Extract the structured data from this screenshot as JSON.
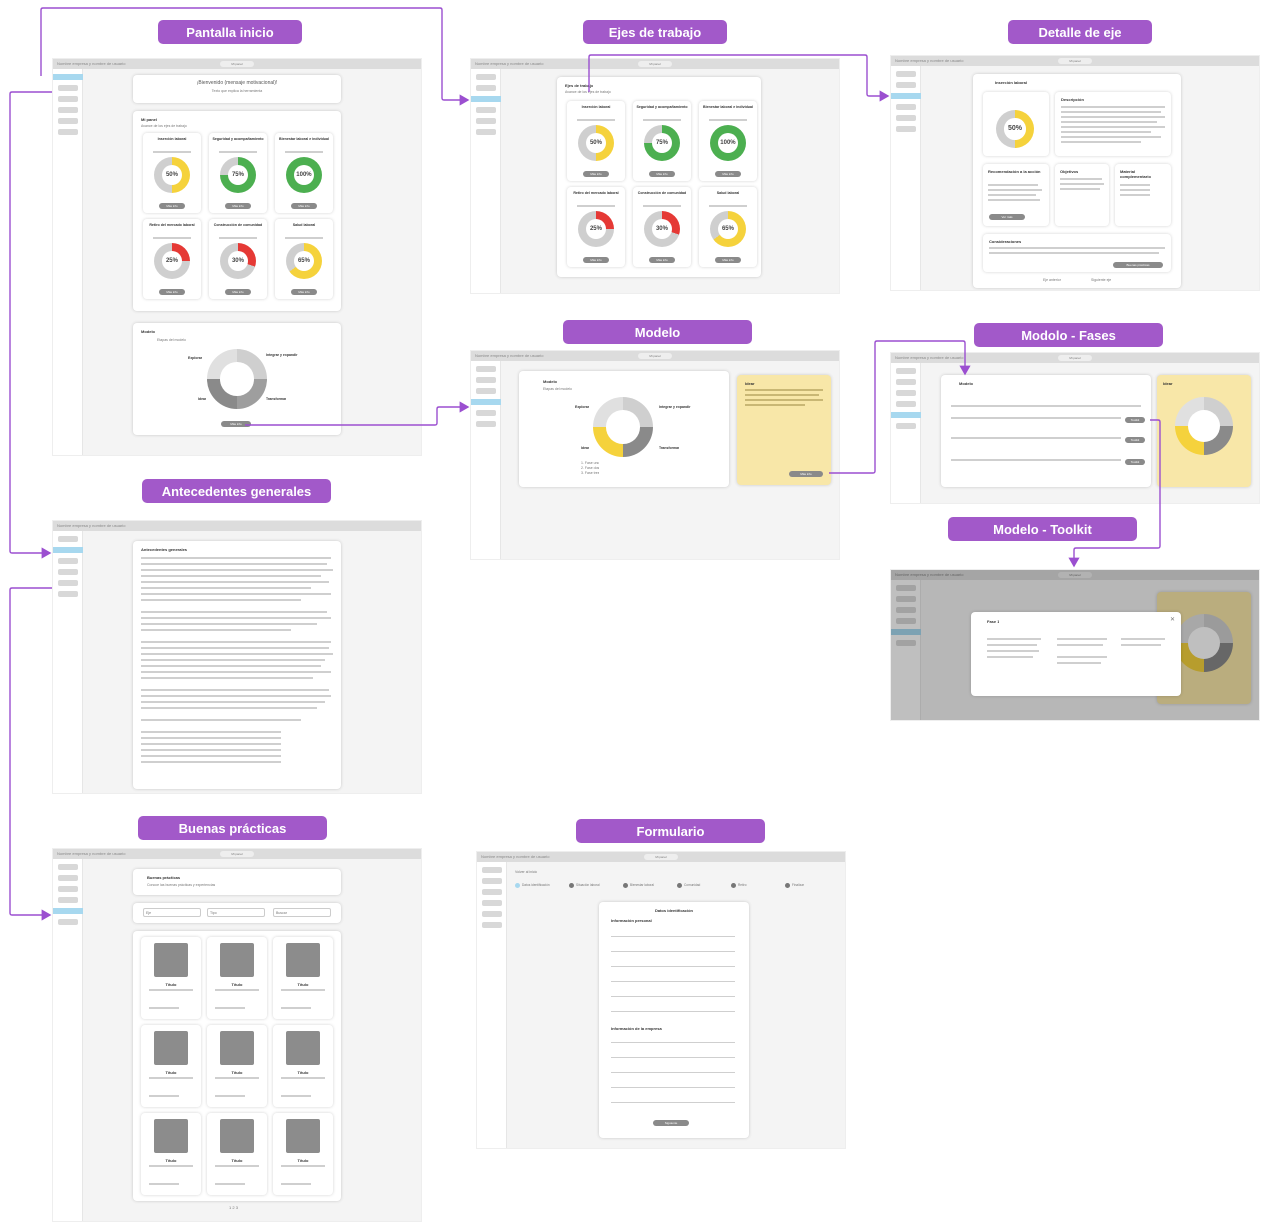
{
  "colors": {
    "accent": "#a259c9",
    "yellow": "#f5d23c",
    "green": "#4caf50",
    "red": "#e53935",
    "gray": "#8a8a8a",
    "panel_yellow": "#f8e7a8",
    "selected": "#a7d8ef"
  },
  "labels": {
    "pantalla_inicio": "Pantalla inicio",
    "ejes_de_trabajo": "Ejes de trabajo",
    "detalle_de_eje": "Detalle de eje",
    "modelo": "Modelo",
    "modelo_fases": "Modolo - Fases",
    "modelo_toolkit": "Modelo - Toolkit",
    "antecedentes_generales": "Antecedentes generales",
    "buenas_practicas": "Buenas prácticas",
    "formulario": "Formulario"
  },
  "home": {
    "welcome": "¡Bienvenido (mensaje motivacional)!",
    "welcome_sub": "Texto que explica la herramienta",
    "panel_title": "Mi panel",
    "panel_sub": "Avance de los ejes de trabajo",
    "axes": [
      {
        "name": "Inserción laboral",
        "pct": "50%",
        "value": 50,
        "color": "yellow"
      },
      {
        "name": "Seguridad y acompañamiento",
        "pct": "75%",
        "value": 75,
        "color": "green"
      },
      {
        "name": "Bienestar laboral e individual",
        "pct": "100%",
        "value": 100,
        "color": "green"
      },
      {
        "name": "Retiro del mercado laboral",
        "pct": "25%",
        "value": 25,
        "color": "red"
      },
      {
        "name": "Construcción de comunidad",
        "pct": "30%",
        "value": 30,
        "color": "red"
      },
      {
        "name": "Salud laboral",
        "pct": "65%",
        "value": 65,
        "color": "yellow"
      }
    ],
    "more_info": "Más info",
    "model_title": "Modelo",
    "model_sub": "Etapas del modelo",
    "model_labels": {
      "explore": "Explorar",
      "integrate": "Integrar y expandir",
      "lead": "Idear",
      "transform": "Transformar"
    }
  },
  "detail": {
    "title": "Inserción laboral",
    "pct": "50%",
    "description_title": "Descripción",
    "recommend_title": "Recomendación a la acción",
    "objectives_title": "Objetivos",
    "material_title": "Material complementario",
    "considerations_title": "Consideraciones",
    "button_practices": "Buenas prácticas",
    "button_more": "Ver más",
    "footer_links": [
      "Eje anterior",
      "Siguiente eje"
    ]
  },
  "modelo": {
    "side_title": "Idear",
    "side_button": "Más info",
    "phases": [
      "1. Fase uno",
      "2. Fase dos",
      "3. Fase tres"
    ]
  },
  "fases": {
    "title": "Modelo",
    "toolkit_button": "Toolkit"
  },
  "toolkit": {
    "modal_title": "Fase 1"
  },
  "antecedentes": {
    "title": "Antecedentes generales"
  },
  "practicas": {
    "title": "Buenas prácticas",
    "subtitle": "Conoce las buenas prácticas y experiencias",
    "filter_axis": "Eje",
    "filter_type": "Tipo",
    "search": "Buscar",
    "card_title": "Título",
    "pages": [
      "1",
      "2",
      "3"
    ]
  },
  "formulario": {
    "back": "Volver al inicio",
    "steps": [
      "Datos identificación",
      "Situación laboral",
      "Bienestar laboral",
      "Comunidad",
      "Retiro",
      "Finalizar"
    ],
    "title": "Datos identificación",
    "section1": "Información personal",
    "section2": "Información de la empresa",
    "submit": "Siguiente"
  },
  "screen": {
    "header_left": "Nombre empresa y nombre de usuario",
    "panel_pill": "Mi panel"
  }
}
